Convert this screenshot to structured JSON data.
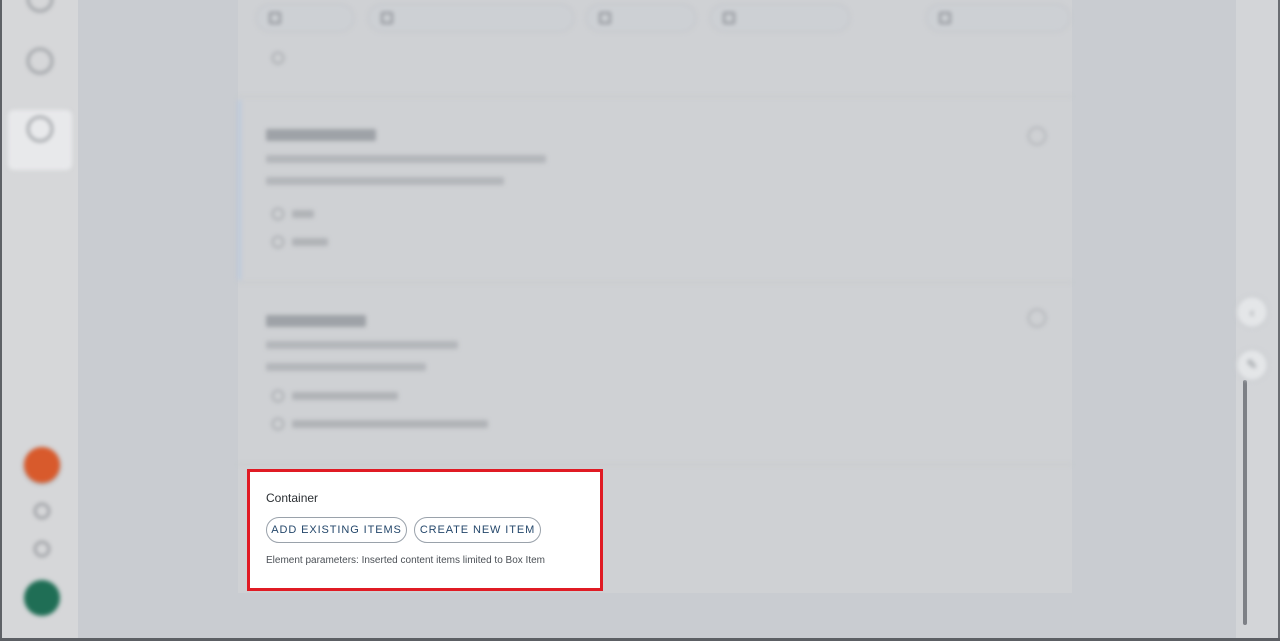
{
  "container": {
    "title": "Container",
    "add_existing_label": "ADD EXISTING ITEMS",
    "create_new_label": "CREATE NEW ITEM",
    "params_text": "Element parameters: Inserted content items limited to Box Item"
  },
  "colors": {
    "highlight": "#e01b24",
    "button_text": "#24476b",
    "fab_orange": "#d85a2c",
    "fab_green": "#1f6e55"
  }
}
